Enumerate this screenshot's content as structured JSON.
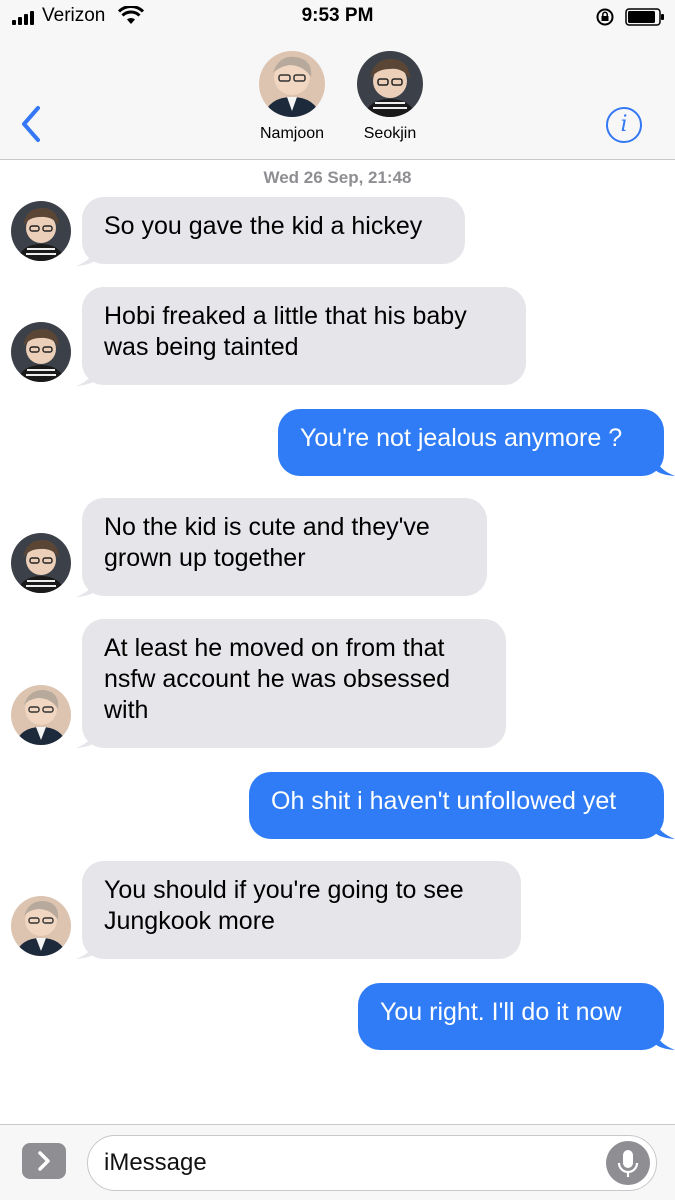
{
  "status_bar": {
    "carrier": "Verizon",
    "time": "9:53 PM",
    "signal_bars": 4,
    "battery_level": 0.9
  },
  "header": {
    "contacts": [
      {
        "name": "Namjoon",
        "avatar_icon": "avatar-photo"
      },
      {
        "name": "Seokjin",
        "avatar_icon": "avatar-photo"
      }
    ],
    "back_icon": "chevron-left-icon",
    "info_icon": "info-icon",
    "info_glyph": "i"
  },
  "conversation": {
    "timestamp": "Wed 26 Sep, 21:48",
    "messages": [
      {
        "direction": "incoming",
        "sender": "Seokjin",
        "lines": [
          "So you gave the kid a hickey"
        ]
      },
      {
        "direction": "incoming",
        "sender": "Seokjin",
        "lines": [
          "Hobi freaked a little that his baby",
          "was being tainted"
        ]
      },
      {
        "direction": "outgoing",
        "lines": [
          "You're not jealous anymore ?"
        ]
      },
      {
        "direction": "incoming",
        "sender": "Seokjin",
        "lines": [
          "No the kid is cute and they've",
          "grown up together"
        ]
      },
      {
        "direction": "incoming",
        "sender": "Namjoon",
        "lines": [
          "At least he moved on from that",
          "nsfw account he was obsessed",
          "with"
        ]
      },
      {
        "direction": "outgoing",
        "lines": [
          "Oh shit i haven't unfollowed yet"
        ]
      },
      {
        "direction": "incoming",
        "sender": "Namjoon",
        "lines": [
          "You should if you're going to see",
          "Jungkook more"
        ]
      },
      {
        "direction": "outgoing",
        "lines": [
          "You right. I'll do it now"
        ]
      }
    ]
  },
  "input_bar": {
    "placeholder": "iMessage",
    "apps_icon": "chevron-right-icon",
    "mic_icon": "microphone-icon"
  },
  "colors": {
    "outgoing_bubble": "#2f7cf6",
    "incoming_bubble": "#e5e5ea",
    "accent": "#3478f6",
    "bar_background": "#f7f7f7"
  }
}
